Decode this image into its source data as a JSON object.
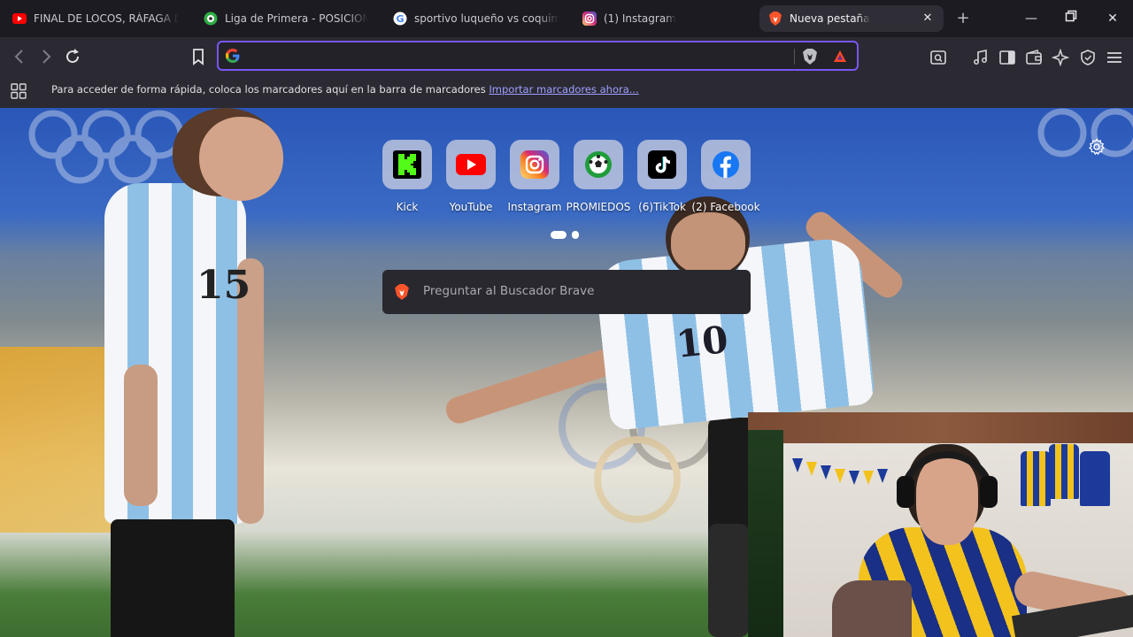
{
  "tabs": [
    {
      "title": "FINAL DE LOCOS, RÁFAGA DE G",
      "favicon": "youtube-icon",
      "active": false
    },
    {
      "title": "Liga de Primera - POSICIONES",
      "favicon": "soccer-ball-icon",
      "active": false
    },
    {
      "title": "sportivo luqueño vs coquimbo",
      "favicon": "google-icon",
      "active": false
    },
    {
      "title": "(1) Instagram",
      "favicon": "instagram-icon",
      "active": false
    },
    {
      "title": "Nueva pestaña",
      "favicon": "brave-icon",
      "active": true
    }
  ],
  "address_bar": {
    "value": "",
    "placeholder": ""
  },
  "bookmarks_bar": {
    "message": "Para acceder de forma rápida, coloca los marcadores aquí en la barra de marcadores",
    "import_link": "Importar marcadores ahora..."
  },
  "top_sites": [
    {
      "label": "Kick",
      "icon": "kick-icon",
      "color": "#53fc18"
    },
    {
      "label": "YouTube",
      "icon": "youtube-icon",
      "color": "#ff0000"
    },
    {
      "label": "Instagram",
      "icon": "instagram-icon",
      "color": "#d62976"
    },
    {
      "label": "PROMIEDOS",
      "icon": "soccer-ball-icon",
      "color": "#1f9d3a"
    },
    {
      "label": "(6)TikTok",
      "icon": "tiktok-icon",
      "color": "#000000"
    },
    {
      "label": "(2) Facebook",
      "icon": "facebook-icon",
      "color": "#1877f2"
    }
  ],
  "top_sites_pages": {
    "count": 2,
    "current": 1
  },
  "search": {
    "placeholder": "Preguntar al Buscador Brave"
  },
  "colors": {
    "accent": "#7a56f5",
    "toolbar": "#2b2a33",
    "tabstrip": "#1c1b22"
  }
}
